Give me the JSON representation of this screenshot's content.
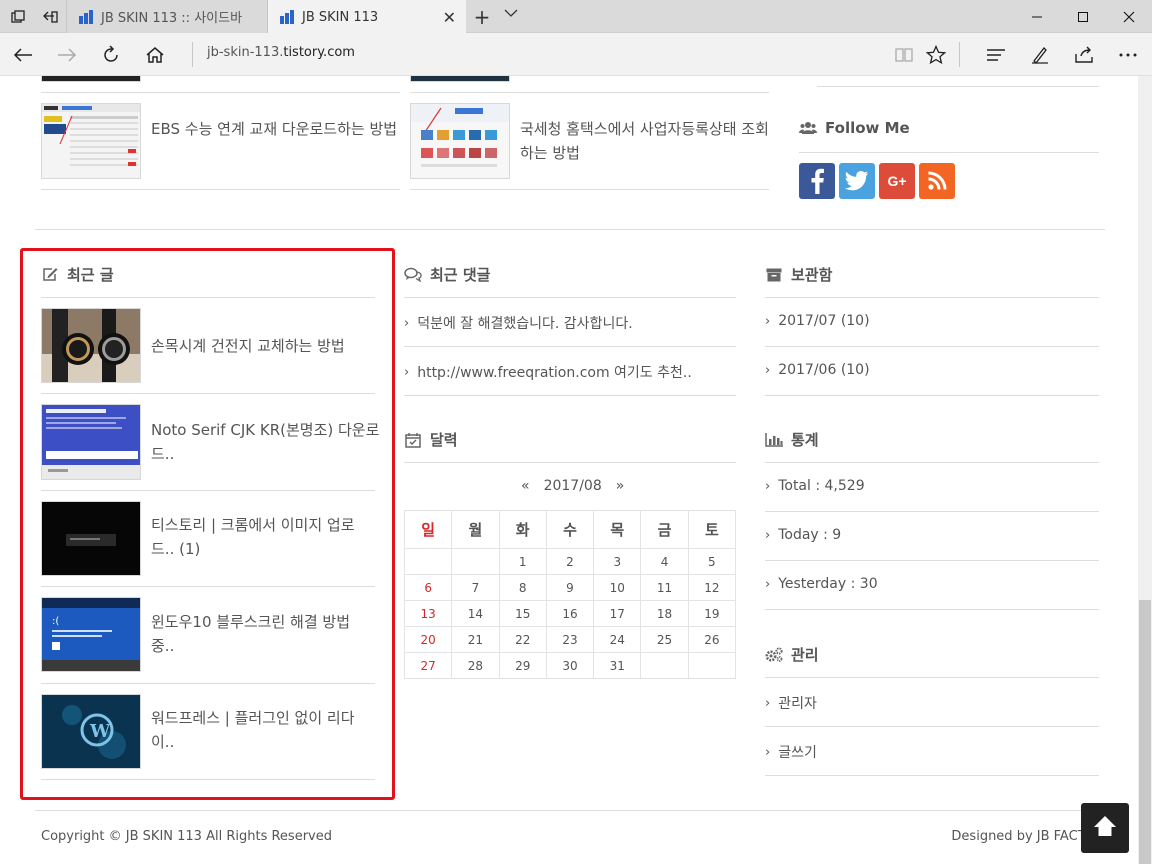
{
  "browser": {
    "tabs": [
      {
        "label": "JB SKIN 113 :: 사이드바",
        "active": false
      },
      {
        "label": "JB SKIN 113",
        "active": true
      }
    ],
    "url_prefix": "jb-skin-113.",
    "url_host": "tistory.com"
  },
  "related_posts": [
    {
      "title": "EBS 수능 연계 교재 다운로드하는 방법"
    },
    {
      "title": "국세청 홈택스에서 사업자등록상태 조회하는 방법"
    }
  ],
  "follow": {
    "title": "Follow Me",
    "icons": [
      {
        "name": "facebook-icon",
        "glyph": "f",
        "color": "#3b5998"
      },
      {
        "name": "twitter-icon",
        "glyph": "t",
        "color": "#4aa3de"
      },
      {
        "name": "google-plus-icon",
        "glyph": "G+",
        "color": "#dd4b39"
      },
      {
        "name": "rss-icon",
        "glyph": "rss",
        "color": "#f26522"
      }
    ]
  },
  "recent_posts": {
    "title": "최근 글",
    "items": [
      {
        "line1": "손목시계 건전지 교체하는 방법",
        "line2": ""
      },
      {
        "line1": "Noto Serif CJK KR(본명조) 다운로",
        "line2": "드.."
      },
      {
        "line1": "티스토리 | 크롬에서 이미지 업로",
        "line2": "드.. (1)"
      },
      {
        "line1": "윈도우10 블루스크린 해결 방법",
        "line2": "중.."
      },
      {
        "line1": "워드프레스 | 플러그인 없이 리다",
        "line2": "이.."
      }
    ]
  },
  "recent_comments": {
    "title": "최근 댓글",
    "items": [
      "덕분에 잘 해결했습니다. 감사합니다.",
      "http://www.freeqration.com 여기도 추천.."
    ]
  },
  "calendar": {
    "title": "달력",
    "prev": "«",
    "month": "2017/08",
    "next": "»",
    "weekdays": [
      "일",
      "월",
      "화",
      "수",
      "목",
      "금",
      "토"
    ],
    "weeks": [
      [
        "",
        "",
        "1",
        "2",
        "3",
        "4",
        "5"
      ],
      [
        "6",
        "7",
        "8",
        "9",
        "10",
        "11",
        "12"
      ],
      [
        "13",
        "14",
        "15",
        "16",
        "17",
        "18",
        "19"
      ],
      [
        "20",
        "21",
        "22",
        "23",
        "24",
        "25",
        "26"
      ],
      [
        "27",
        "28",
        "29",
        "30",
        "31",
        "",
        ""
      ]
    ]
  },
  "archive": {
    "title": "보관함",
    "items": [
      "2017/07 (10)",
      "2017/06 (10)"
    ]
  },
  "stats": {
    "title": "통계",
    "items": [
      "Total : 4,529",
      "Today : 9",
      "Yesterday : 30"
    ]
  },
  "admin": {
    "title": "관리",
    "items": [
      "관리자",
      "글쓰기"
    ]
  },
  "footer": {
    "copyright": "Copyright © JB SKIN 113 All Rights Reserved",
    "designed_by": "Designed by JB FACTORY"
  },
  "colors": {
    "highlight_border": "#e2121b",
    "sunday": "#d42a2a"
  }
}
